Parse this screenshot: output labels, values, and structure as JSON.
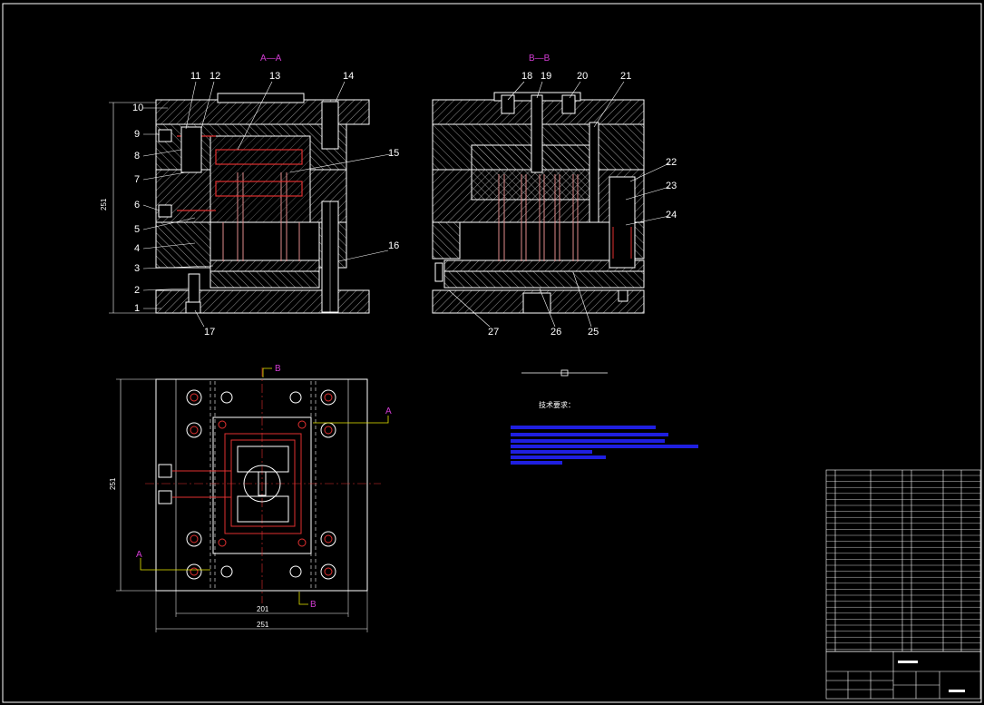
{
  "drawing": {
    "section_aa": "A—A",
    "section_bb": "B—B",
    "height_dim": "251",
    "plan_height_dim": "251",
    "plan_width_inner": "201",
    "plan_width_outer": "251",
    "cut_a": "A",
    "cut_b": "B",
    "tech_title": "技术要求：",
    "part_numbers_left": [
      "1",
      "2",
      "3",
      "4",
      "5",
      "6",
      "7",
      "8",
      "9",
      "10",
      "11",
      "12",
      "13",
      "14",
      "15",
      "16",
      "17"
    ],
    "part_numbers_right": [
      "18",
      "19",
      "20",
      "21",
      "22",
      "23",
      "24",
      "25",
      "26",
      "27"
    ]
  },
  "colors": {
    "background": "#000000",
    "outline": "#ffffff",
    "hatch": "#bfbfbf",
    "cooling": "#e03030",
    "hidden": "#e08c8c",
    "section_label": "#d23cd2",
    "notes_bar": "#1f1fe0"
  }
}
